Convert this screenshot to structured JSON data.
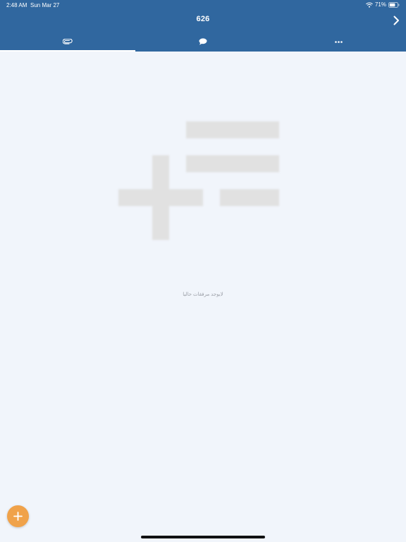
{
  "statusbar": {
    "time": "2:48 AM",
    "date": "Sun Mar 27",
    "battery": "71%"
  },
  "header": {
    "title": "626"
  },
  "tabs": [
    {
      "icon": "paperclip-icon",
      "active": true
    },
    {
      "icon": "chat-bubble-icon",
      "active": false
    },
    {
      "icon": "more-icon",
      "active": false
    }
  ],
  "empty_state": {
    "message": "لايوجد مرفقات حاليا"
  },
  "colors": {
    "header": "#30679f",
    "background": "#f1f5fb",
    "fab": "#f0a24a",
    "illustration": "#e1e1e1"
  }
}
